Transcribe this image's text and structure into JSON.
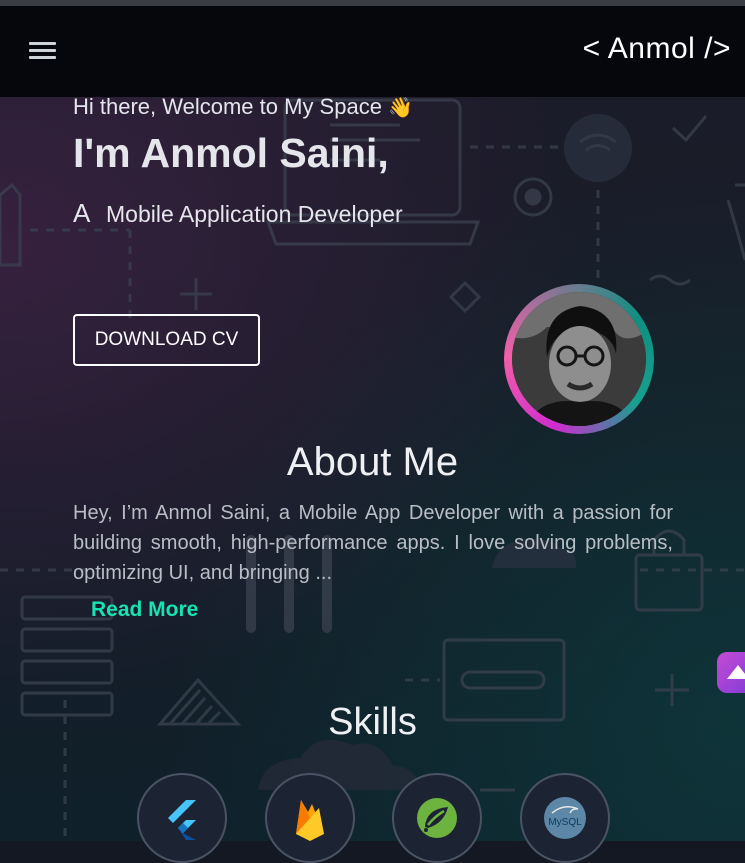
{
  "header": {
    "menu_icon": "hamburger-menu-icon",
    "logo": "< Anmol />"
  },
  "hero": {
    "greeting": "Hi there, Welcome to My Space",
    "greeting_emoji": "👋",
    "name": "I'm Anmol Saini,",
    "role_prefix": "A",
    "role": "Mobile Application Developer",
    "cv_button": "DOWNLOAD CV",
    "avatar_icon": "profile-photo"
  },
  "about": {
    "title": "About Me",
    "text": "Hey, I’m Anmol Saini, a Mobile App Developer with a passion for building smooth, high-performance apps. I love solving problems, optimizing UI, and bringing ...",
    "read_more": "Read More"
  },
  "skills": {
    "title": "Skills",
    "items": [
      {
        "icon": "flutter-icon"
      },
      {
        "icon": "firebase-icon"
      },
      {
        "icon": "spring-icon"
      },
      {
        "icon": "mysql-icon",
        "label": "MySQL"
      }
    ]
  },
  "scroll_top_icon": "arrow-up-icon",
  "colors": {
    "accent_teal": "#17e3b2",
    "ring_pink": "#d02ccf",
    "ring_teal": "#17a08f",
    "header_bg": "#05070d",
    "scroll_button": "#9b43d6"
  }
}
